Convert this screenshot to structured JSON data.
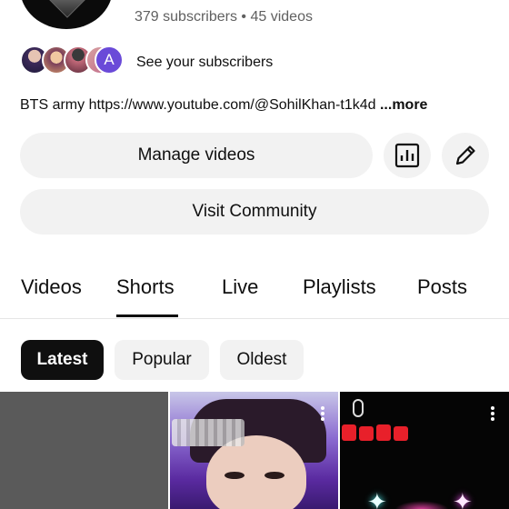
{
  "channel": {
    "subscriber_count_text": "379 subscribers",
    "video_count_text": "45 videos",
    "stats_separator": "•",
    "see_subscribers_label": "See your subscribers",
    "subscriber_avatar_letter": "A",
    "description": "BTS army https://www.youtube.com/@SohilKhan-t1k4d",
    "more_label": "...more"
  },
  "actions": {
    "manage_videos_label": "Manage videos",
    "analytics_icon": "analytics-icon",
    "edit_icon": "pencil-icon",
    "visit_community_label": "Visit Community"
  },
  "tabs": [
    {
      "label": "Videos"
    },
    {
      "label": "Shorts",
      "selected": true
    },
    {
      "label": "Live"
    },
    {
      "label": "Playlists"
    },
    {
      "label": "Posts"
    }
  ],
  "filters": [
    {
      "label": "Latest",
      "selected": true
    },
    {
      "label": "Popular"
    },
    {
      "label": "Oldest"
    }
  ],
  "colors": {
    "text": "#0f0f0f",
    "secondary_text": "#606060",
    "chip_bg": "#f2f2f2",
    "selected_chip_bg": "#0f0f0f",
    "avatar_accent": "#6a4ad8"
  }
}
